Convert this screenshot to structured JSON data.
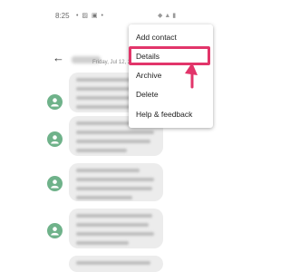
{
  "status_bar": {
    "time": "8:25",
    "notification_icons": "• ▨ ▣ •",
    "right_icons": "◆ ▲ ▮"
  },
  "conversation": {
    "date_label": "Friday, Jul 12, 2"
  },
  "menu": {
    "items": [
      {
        "label": "Add contact"
      },
      {
        "label": "Details"
      },
      {
        "label": "Archive"
      },
      {
        "label": "Delete"
      },
      {
        "label": "Help & feedback"
      }
    ],
    "highlighted_item": "Details"
  },
  "colors": {
    "highlight": "#e2356a",
    "avatar": "#6fb28a",
    "bubble": "#ececec"
  }
}
